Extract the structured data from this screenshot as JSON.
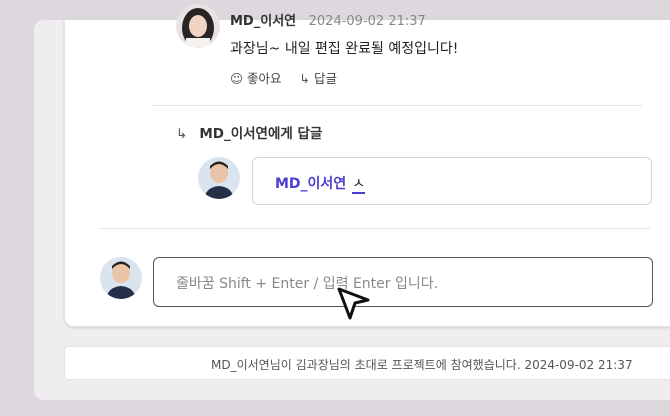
{
  "comment": {
    "author": "MD_이서연",
    "date": "2024-09-02 21:37",
    "text": "과장님~ 내일 편집 완료될 예정입니다!",
    "like_label": "좋아요",
    "reply_label": "답글"
  },
  "reply": {
    "to_label": "MD_이서연에게 답글",
    "mention": "MD_이서연",
    "typed": "ㅅ"
  },
  "main_input": {
    "placeholder": "줄바꿈 Shift + Enter / 입력 Enter 입니다."
  },
  "activity_log": {
    "text": "MD_이서연님이 김과장님의 초대로 프로젝트에 참여했습니다. 2024-09-02 21:37"
  },
  "icons": {
    "like": "smile-icon",
    "reply": "reply-arrow-icon",
    "cursor": "mouse-pointer-icon"
  },
  "colors": {
    "mention": "#4b3fd1",
    "background": "#ddd8de"
  }
}
